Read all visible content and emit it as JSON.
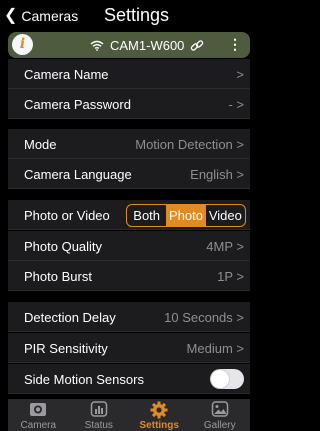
{
  "header": {
    "back_label": "Cameras",
    "title": "Settings"
  },
  "device": {
    "name": "CAM1-W600"
  },
  "settings": {
    "camera_name": {
      "label": "Camera Name",
      "value": ">"
    },
    "camera_password": {
      "label": "Camera Password",
      "value": "- >"
    },
    "mode": {
      "label": "Mode",
      "value": "Motion Detection >"
    },
    "camera_language": {
      "label": "Camera Language",
      "value": "English >"
    },
    "photo_or_video": {
      "label": "Photo or Video",
      "options": [
        "Both",
        "Photo",
        "Video"
      ],
      "selected": "Photo"
    },
    "photo_quality": {
      "label": "Photo Quality",
      "value": "4MP >"
    },
    "photo_burst": {
      "label": "Photo Burst",
      "value": "1P >"
    },
    "detection_delay": {
      "label": "Detection Delay",
      "value": "10 Seconds >"
    },
    "pir_sensitivity": {
      "label": "PIR Sensitivity",
      "value": "Medium >"
    },
    "side_motion_sensors": {
      "label": "Side Motion Sensors",
      "enabled": false
    }
  },
  "tabs": [
    {
      "label": "Camera",
      "icon": "camera-icon"
    },
    {
      "label": "Status",
      "icon": "status-icon"
    },
    {
      "label": "Settings",
      "icon": "settings-gear-icon",
      "active": true
    },
    {
      "label": "Gallery",
      "icon": "gallery-icon"
    }
  ],
  "colors": {
    "accent": "#e28a24",
    "device_bar": "#4f5b3f",
    "row_bg": "#1c1c1e",
    "page_bg": "#000000"
  }
}
